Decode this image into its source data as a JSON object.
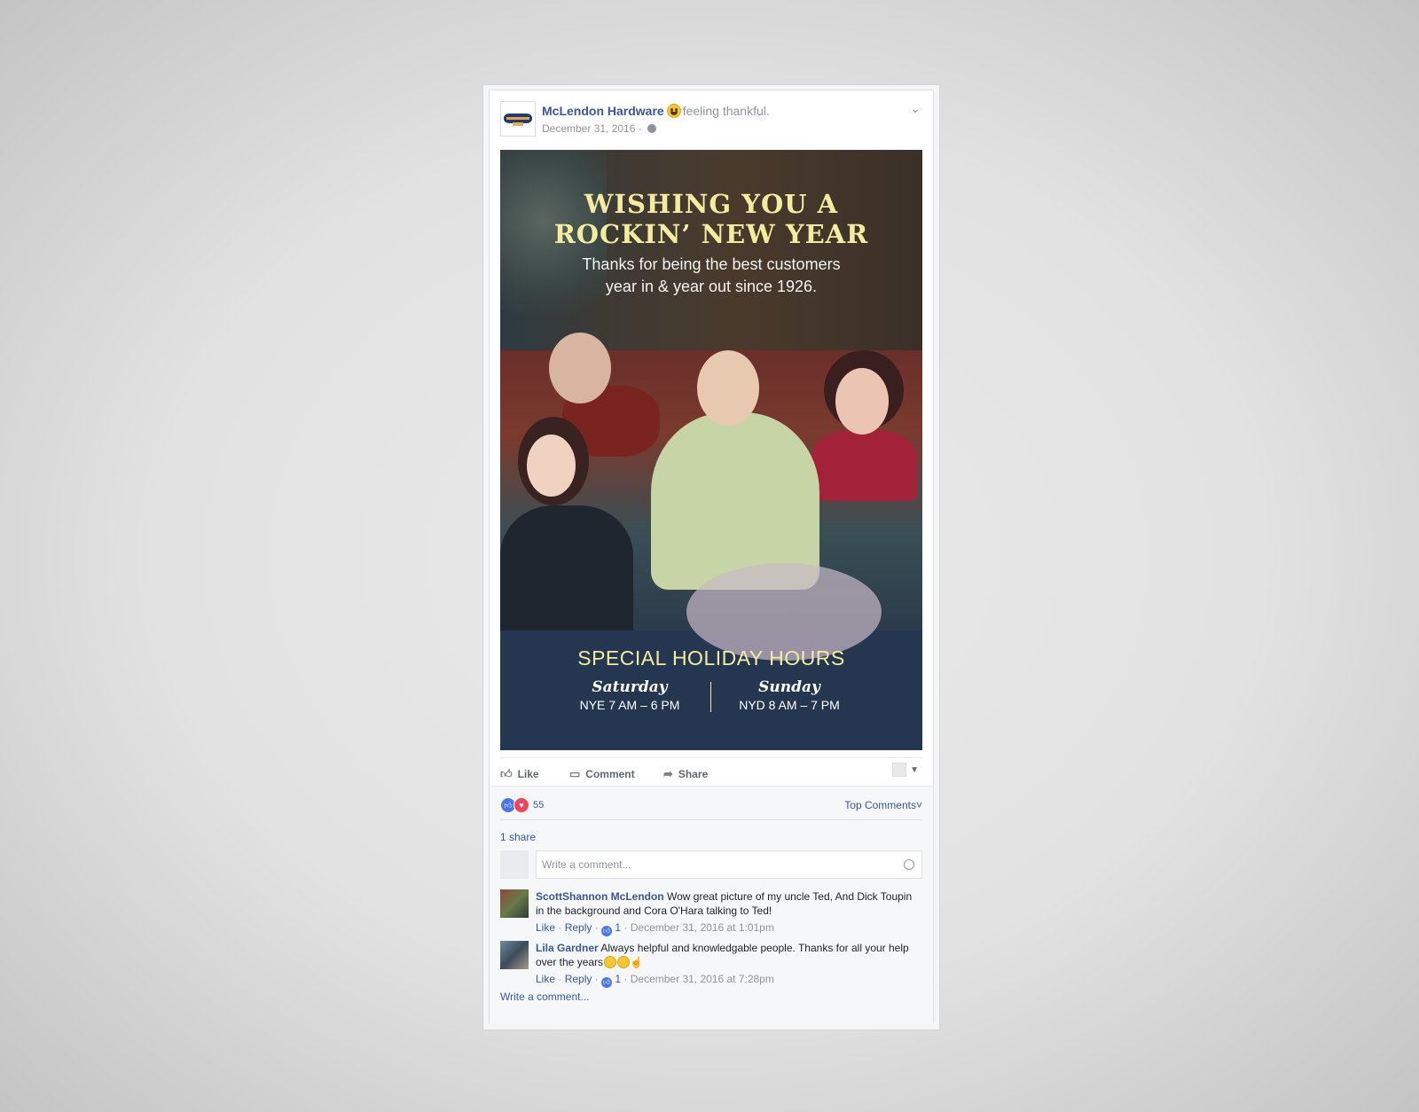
{
  "post": {
    "page_name": "McLendon Hardware",
    "feeling": "feeling thankful.",
    "date": "December 31, 2016 ·",
    "image": {
      "headline_line1": "WISHING YOU A",
      "headline_line2": "ROCKIN’ NEW YEAR",
      "sub_line1": "Thanks for being the best customers",
      "sub_line2": "year in & year out since 1926.",
      "hours_title": "SPECIAL HOLIDAY HOURS",
      "day1_name": "Saturday",
      "day1_hours": "NYE 7 AM – 6 PM",
      "day2_name": "Sunday",
      "day2_hours": "NYD 8 AM – 7 PM"
    }
  },
  "actions": {
    "like": "Like",
    "comment": "Comment",
    "share": "Share"
  },
  "ufi": {
    "reaction_count": "55",
    "top_comments": "Top Comments",
    "shares": "1 share",
    "composer_placeholder": "Write a comment...",
    "write_comment": "Write a comment..."
  },
  "comments": [
    {
      "author": "ScottShannon McLendon",
      "text": "Wow great picture of my uncle Ted, And Dick Toupin in the background and Cora O'Hara talking to Ted!",
      "like_label": "Like",
      "reply_label": "Reply",
      "likes": "1",
      "time": "December 31, 2016 at 1:01pm"
    },
    {
      "author": "Lila Gardner",
      "text": "Always helpful and knowledgable people. Thanks for all your help over the years",
      "like_label": "Like",
      "reply_label": "Reply",
      "likes": "1",
      "time": "December 31, 2016 at 7:28pm"
    }
  ],
  "colors": {
    "link_blue": "#365899",
    "image_navy": "#253750",
    "headline_yellow": "#f3ec9f"
  }
}
